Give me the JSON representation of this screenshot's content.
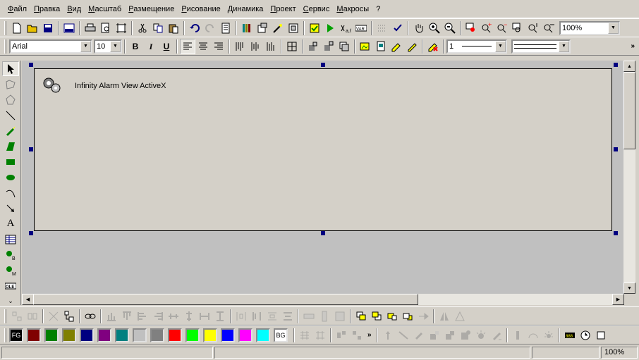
{
  "menu": [
    "Файл",
    "Правка",
    "Вид",
    "Масштаб",
    "Размещение",
    "Рисование",
    "Динамика",
    "Проект",
    "Сервис",
    "Макросы",
    "?"
  ],
  "toolbar1": {
    "zoom_value": "100%"
  },
  "toolbar2": {
    "font_value": "Arial",
    "size_value": "10",
    "bold_label": "B",
    "italic_label": "I",
    "underline_label": "U",
    "line_width_value": "1"
  },
  "canvas": {
    "activex_label": "Infinity Alarm View ActiveX"
  },
  "palette": {
    "fg_label": "FG",
    "bg_label": "BG",
    "colors": [
      "#800000",
      "#008000",
      "#808000",
      "#000080",
      "#800080",
      "#008080",
      "#c0c0c0",
      "#808080",
      "#ff0000",
      "#00ff00",
      "#ffff00",
      "#0000ff",
      "#ff00ff",
      "#00ffff"
    ]
  },
  "status": {
    "zoom": "100%"
  },
  "icons": {
    "chevron": "»"
  }
}
